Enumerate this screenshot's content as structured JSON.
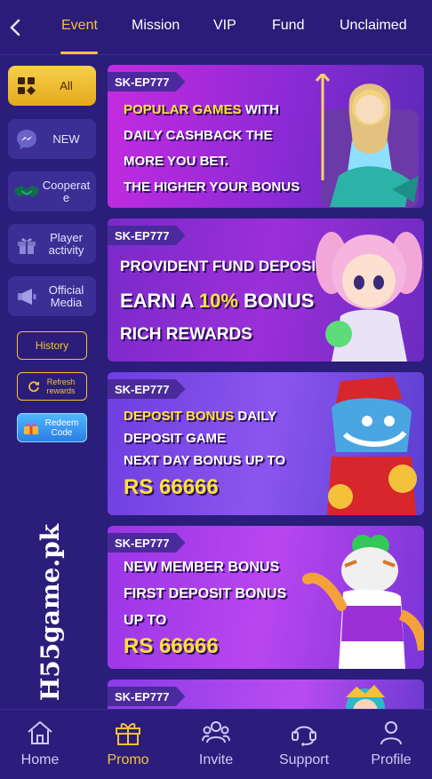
{
  "tabs": [
    {
      "label": "Event",
      "active": true
    },
    {
      "label": "Mission"
    },
    {
      "label": "VIP"
    },
    {
      "label": "Fund"
    },
    {
      "label": "Unclaimed"
    }
  ],
  "sidebar": {
    "items": [
      {
        "label": "All",
        "icon": "grid-icon",
        "active": true
      },
      {
        "label": "NEW",
        "icon": "messenger-icon"
      },
      {
        "label": "Cooperate",
        "icon": "handshake-icon"
      },
      {
        "label": "Player activity",
        "icon": "gift-icon"
      },
      {
        "label": "Official Media",
        "icon": "megaphone-icon"
      }
    ],
    "history_label": "History",
    "refresh_label": "Refresh rewards",
    "redeem_label": "Redeem Code"
  },
  "watermark": "H55game.pk",
  "banners": [
    {
      "tag": "SK-EP777",
      "lines": [
        "POPULAR GAMES",
        "WITH",
        "DAILY CASHBACK THE",
        "MORE YOU BET.",
        "THE HIGHER YOUR BONUS"
      ]
    },
    {
      "tag": "SK-EP777",
      "lines": [
        "PROVIDENT FUND DEPOSIT",
        "EARN A",
        "10%",
        "BONUS",
        "RICH REWARDS"
      ]
    },
    {
      "tag": "SK-EP777",
      "lines": [
        "DEPOSIT BONUS",
        "DAILY",
        "DEPOSIT GAME",
        "NEXT DAY BONUS UP TO",
        "RS 66666"
      ]
    },
    {
      "tag": "SK-EP777",
      "lines": [
        "NEW MEMBER BONUS",
        "FIRST DEPOSIT BONUS",
        "UP TO",
        "RS 66666"
      ]
    },
    {
      "tag": "SK-EP777"
    }
  ],
  "bottom_nav": [
    {
      "label": "Home",
      "icon": "home-icon"
    },
    {
      "label": "Promo",
      "icon": "gift-box-icon",
      "active": true
    },
    {
      "label": "Invite",
      "icon": "users-icon"
    },
    {
      "label": "Support",
      "icon": "headset-icon"
    },
    {
      "label": "Profile",
      "icon": "person-icon"
    }
  ],
  "colors": {
    "accent": "#f4c23a",
    "background": "#2b1d7a",
    "highlight": "#ffe23a"
  }
}
